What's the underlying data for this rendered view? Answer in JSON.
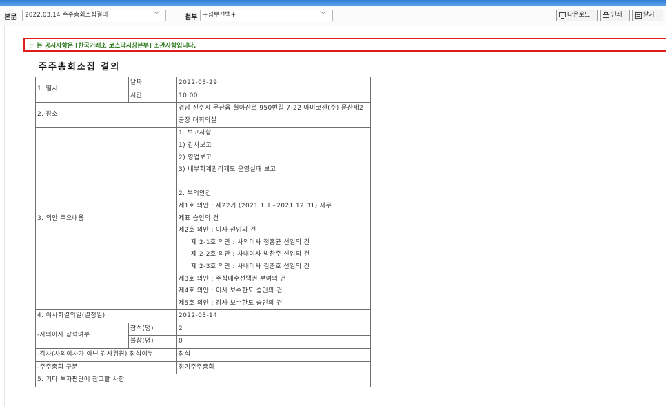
{
  "toolbar": {
    "body_label": "본문",
    "body_select_value": "2022.03.14  주주총회소집결의",
    "attach_label": "첨부",
    "attach_select_value": "+첨부선택+",
    "buttons": {
      "download": "다운로드",
      "print": "인쇄",
      "close": "닫기"
    }
  },
  "notice": "☞ 본 공시사항은 [한국거래소 코스닥시장본부] 소관사항입니다.",
  "document": {
    "title": "주주총회소집 결의",
    "rows": {
      "date_time": {
        "label": "1. 일시",
        "date_label": "날짜",
        "date_value": "2022-03-29",
        "time_label": "시간",
        "time_value": "10:00"
      },
      "place": {
        "label": "2. 장소",
        "value": "경남 진주시 문산읍 월아산로 950번길 7-22 아미코젠(주) 문산제2공장 대회의실"
      },
      "agenda": {
        "label": "3. 의안 주요내용",
        "lines": [
          "1. 보고사항",
          "1) 감사보고",
          "2) 영업보고",
          "3) 내부회계관리제도 운영실태 보고",
          "",
          "2. 부의안건",
          "제1호 의안 : 제22기 (2021.1.1~2021.12.31) 재무",
          "제표 승인의 건",
          "제2호 의안 : 이사 선임의 건",
          "제 2-1호 의안 : 사외이사 정홍균 선임의 건",
          "제 2-2호 의안 : 사내이사 박찬주 선임의 건",
          "제 2-3호 의안 : 사내이사 김준호 선임의 건",
          "제3호 의안 : 주식매수선택권 부여의 건",
          "제4호 의안 : 이사 보수한도 승인의 건",
          "제5호 의안 : 감사 보수한도 승인의 건"
        ]
      },
      "board_date": {
        "label": "4. 이사회결의일(결정일)",
        "value": "2022-03-14"
      },
      "outside_directors": {
        "label": "-사외이사 참석여부",
        "present_label": "참석(명)",
        "present_value": "2",
        "absent_label": "불참(명)",
        "absent_value": "0"
      },
      "auditor": {
        "label": "-감사(사외이사가 아닌 감사위원) 참석여부",
        "value": "참석"
      },
      "meeting_type": {
        "label": "-주주총회 구분",
        "value": "정기주주총회"
      },
      "other": {
        "label": "5. 기타 투자판단에 참고할 사항"
      }
    }
  }
}
